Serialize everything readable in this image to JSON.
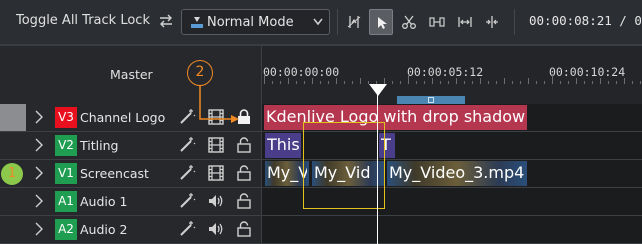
{
  "toolbar": {
    "toggle_lock_label": "Toggle All Track Lock",
    "mode_label": "Normal Mode",
    "timecode": "00:00:08:21 / 00"
  },
  "header": {
    "master_label": "Master",
    "ruler": [
      "00:00:00:00",
      "00:00:05:12",
      "00:00:10:24"
    ]
  },
  "annotations": {
    "callout_1": "1",
    "callout_2": "2"
  },
  "tracks": [
    {
      "badge": "V3",
      "name": "Channel Logo",
      "badge_color": "#e8101e",
      "locked": true,
      "clips": [
        {
          "text": "Kdenlive Logo with drop shadow",
          "color": "#b5364f"
        }
      ]
    },
    {
      "badge": "V2",
      "name": "Titling",
      "badge_color": "#1f9e52",
      "locked": false,
      "clips": [
        {
          "text": "This i",
          "color": "#4a3e8a"
        },
        {
          "text": "T",
          "color": "#4a3e8a"
        }
      ]
    },
    {
      "badge": "V1",
      "name": "Screencast",
      "badge_color": "#1f9e52",
      "locked": false,
      "clips": [
        {
          "text": "My_V",
          "color": "#2a4f7a"
        },
        {
          "text": "My_Vid",
          "color": "#2a4f7a"
        },
        {
          "text": "My_Video_3.mp4",
          "color": "#2a4f7a"
        }
      ]
    },
    {
      "badge": "A1",
      "name": "Audio 1",
      "badge_color": "#1f9e52",
      "locked": false,
      "clips": []
    },
    {
      "badge": "A2",
      "name": "Audio 2",
      "badge_color": "#1f9e52",
      "locked": false,
      "clips": []
    }
  ],
  "icons": {
    "swap": "swap-arrows-icon",
    "mode": "normal-mode-icon",
    "tools": [
      "spacer-tool-icon",
      "select-tool-icon",
      "razor-tool-icon",
      "slip-tool-icon",
      "ripple-tool-icon",
      "multicam-tool-icon"
    ]
  }
}
